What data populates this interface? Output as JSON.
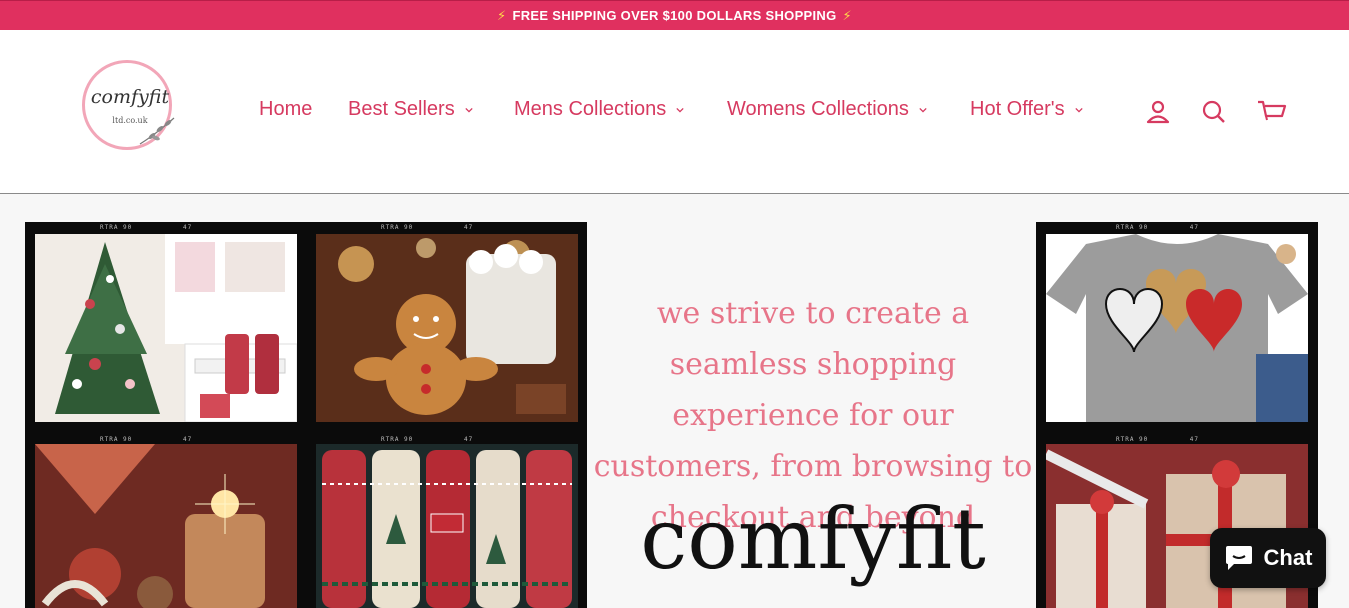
{
  "announcement": {
    "text": "FREE SHIPPING OVER $100 DOLLARS SHOPPING",
    "icon": "lightning-bolt-icon"
  },
  "logo": {
    "script": "comfyfit",
    "sub": "ltd.co.uk"
  },
  "nav": {
    "items": [
      {
        "label": "Home",
        "has_dropdown": false
      },
      {
        "label": "Best Sellers",
        "has_dropdown": true
      },
      {
        "label": "Mens Collections",
        "has_dropdown": true
      },
      {
        "label": "Womens Collections",
        "has_dropdown": true
      },
      {
        "label": "Hot Offer's",
        "has_dropdown": true
      }
    ],
    "icons": [
      "account-icon",
      "search-icon",
      "cart-icon"
    ]
  },
  "hero": {
    "tagline": "we strive to create a seamless shopping experience for our customers, from browsing to checkout and beyond",
    "brand": "comfyfit"
  },
  "chat": {
    "label": "Chat",
    "icon": "chat-bubble-icon"
  },
  "colors": {
    "accent": "#e0305f",
    "nav_text": "#d63a60",
    "tagline": "#e77589"
  }
}
